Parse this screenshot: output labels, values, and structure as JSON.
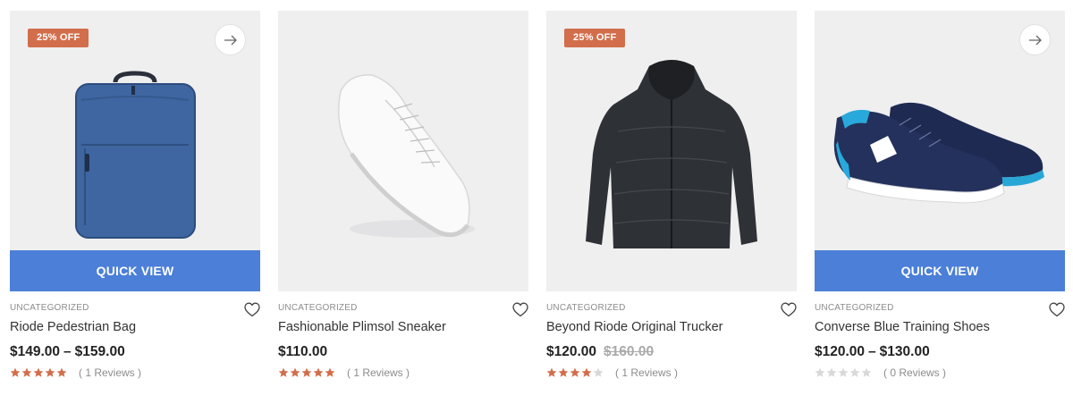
{
  "colors": {
    "badge": "#d26e4b",
    "quick_view": "#4b7fd8",
    "star_filled": "#d26e4b",
    "star_empty": "#d8d8d8"
  },
  "products": [
    {
      "badge": "25% OFF",
      "quick_view": "QUICK VIEW",
      "category": "UNCATEGORIZED",
      "name": "Riode Pedestrian Bag",
      "price_low": "$149.00",
      "price_sep": "–",
      "price_high": "$159.00",
      "rating": 5,
      "reviews": "( 1 Reviews )",
      "image_icon": "backpack-image"
    },
    {
      "category": "UNCATEGORIZED",
      "name": "Fashionable Plimsol Sneaker",
      "price": "$110.00",
      "rating": 5,
      "reviews": "( 1 Reviews )",
      "image_icon": "sneaker-image"
    },
    {
      "badge": "25% OFF",
      "category": "UNCATEGORIZED",
      "name": "Beyond Riode Original Trucker",
      "price": "$120.00",
      "price_old": "$160.00",
      "rating": 4,
      "reviews": "( 1 Reviews )",
      "image_icon": "jacket-image"
    },
    {
      "quick_view": "QUICK VIEW",
      "category": "UNCATEGORIZED",
      "name": "Converse Blue Training Shoes",
      "price_low": "$120.00",
      "price_sep": "–",
      "price_high": "$130.00",
      "rating": 0,
      "reviews": "( 0 Reviews )",
      "image_icon": "running-shoes-image"
    }
  ]
}
